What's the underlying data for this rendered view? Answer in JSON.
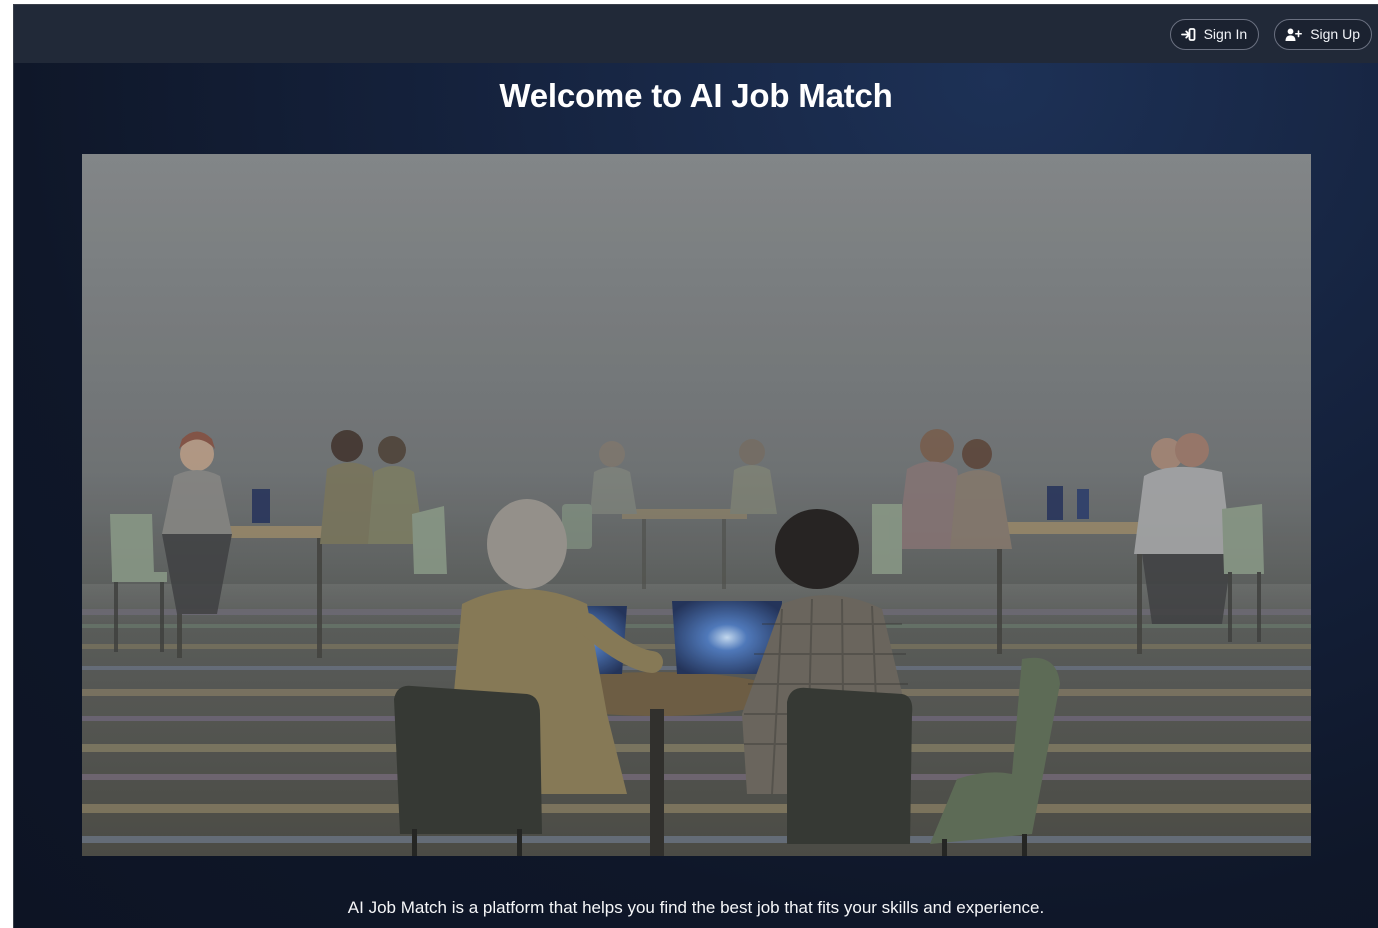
{
  "header": {
    "sign_in_label": "Sign In",
    "sign_in_icon": "sign-in-icon",
    "sign_up_label": "Sign Up",
    "sign_up_icon": "user-plus-icon"
  },
  "main": {
    "title": "Welcome to AI Job Match",
    "hero_image": "people-working-on-laptops-illustration",
    "tagline": "AI Job Match is a platform that helps you find the best job that fits your skills and experience."
  },
  "colors": {
    "app_background": "#0f1729",
    "topbar_background": "#212938",
    "button_border": "#6a7080",
    "text": "#ffffff"
  }
}
